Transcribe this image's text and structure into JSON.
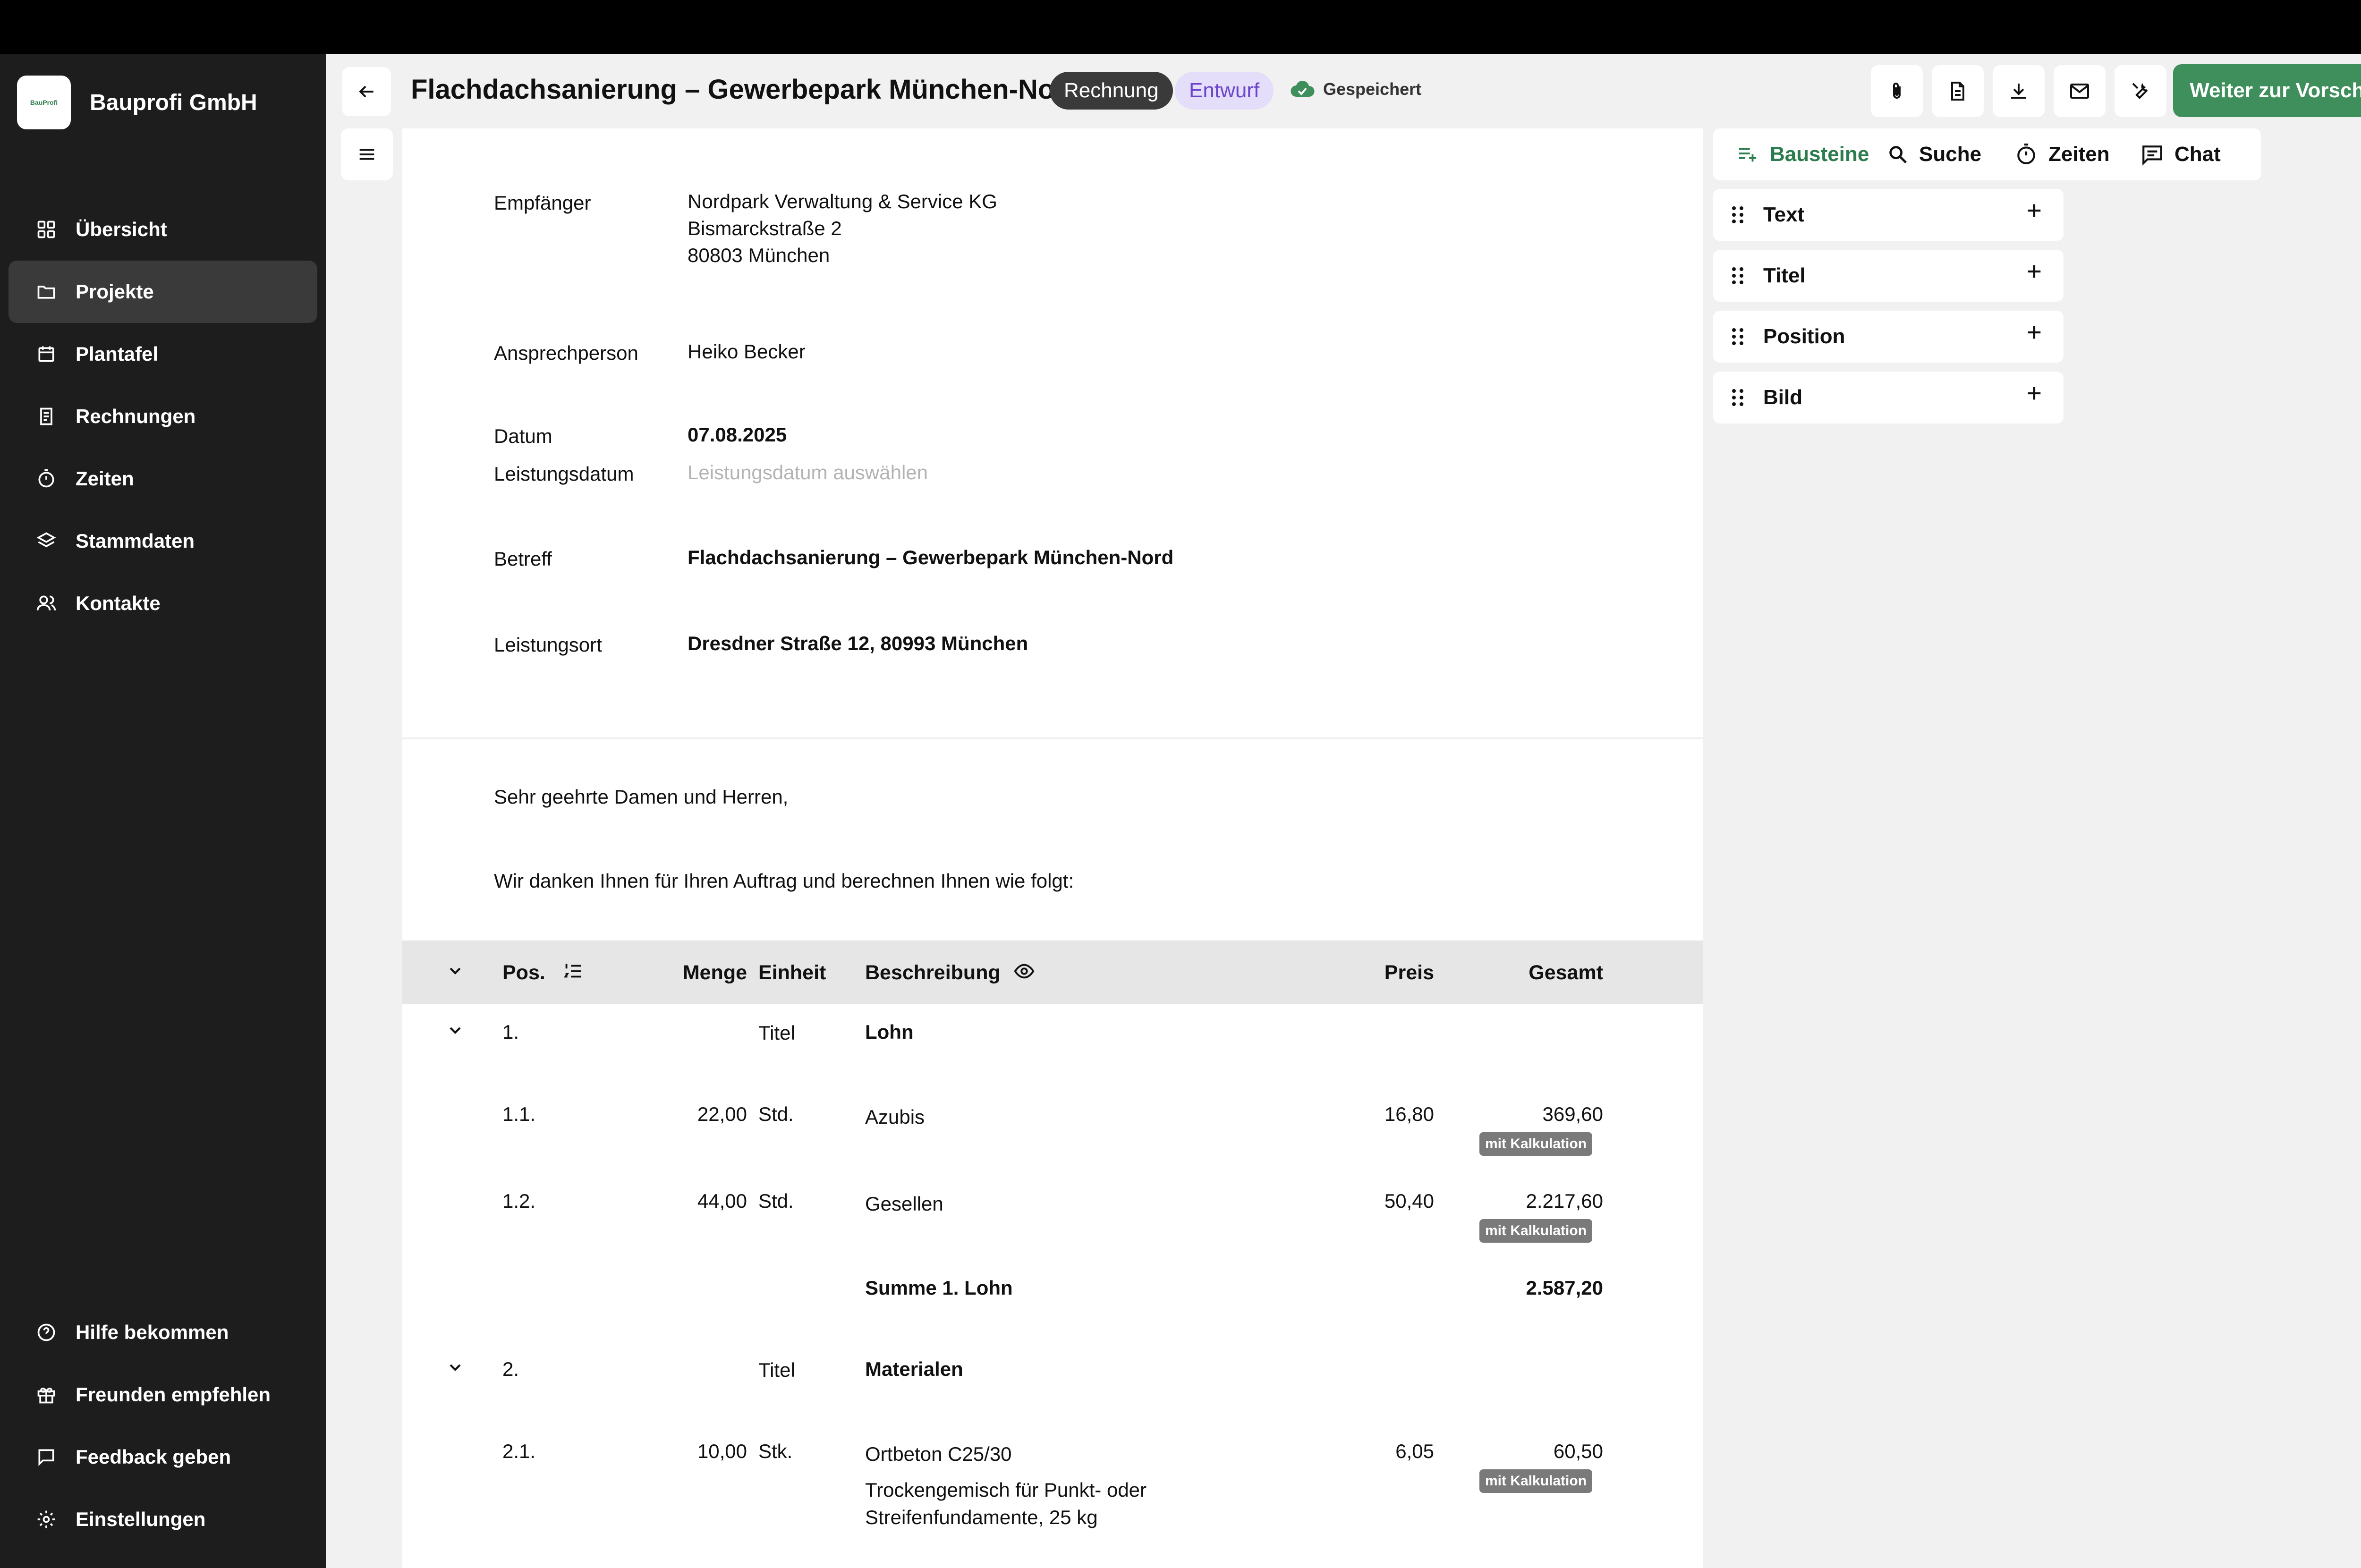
{
  "brand": {
    "name": "Bauprofi GmbH",
    "logo_text": "BauProfi"
  },
  "sidebar": {
    "items": [
      {
        "label": "Übersicht",
        "icon": "grid-icon"
      },
      {
        "label": "Projekte",
        "icon": "folder-icon",
        "active": true
      },
      {
        "label": "Plantafel",
        "icon": "calendar-icon"
      },
      {
        "label": "Rechnungen",
        "icon": "receipt-icon"
      },
      {
        "label": "Zeiten",
        "icon": "stopwatch-icon"
      },
      {
        "label": "Stammdaten",
        "icon": "layers-icon"
      },
      {
        "label": "Kontakte",
        "icon": "contacts-icon"
      }
    ],
    "bottom_items": [
      {
        "label": "Hilfe bekommen",
        "icon": "help-icon"
      },
      {
        "label": "Freunden empfehlen",
        "icon": "gift-icon"
      },
      {
        "label": "Feedback geben",
        "icon": "feedback-icon"
      },
      {
        "label": "Einstellungen",
        "icon": "gear-icon"
      }
    ]
  },
  "header": {
    "title": "Flachdachsanierung – Gewerbepark München-Nord",
    "type_badge": "Rechnung",
    "status_badge": "Entwurf",
    "saved_label": "Gespeichert",
    "preview_button": "Weiter zur Vorschau",
    "actions": [
      "paperclip-icon",
      "document-icon",
      "download-icon",
      "mail-icon",
      "tools-icon"
    ]
  },
  "document": {
    "recipient_label": "Empfänger",
    "recipient_lines": [
      "Nordpark Verwaltung & Service KG",
      "Bismarckstraße 2",
      "80803 München"
    ],
    "contact_label": "Ansprechperson",
    "contact_value": "Heiko Becker",
    "date_label": "Datum",
    "date_value": "07.08.2025",
    "service_date_label": "Leistungsdatum",
    "service_date_placeholder": "Leistungsdatum auswählen",
    "subject_label": "Betreff",
    "subject_value": "Flachdachsanierung – Gewerbepark München-Nord",
    "location_label": "Leistungsort",
    "location_value": "Dresdner Straße 12, 80993 München",
    "greeting": "Sehr geehrte Damen und Herren,",
    "intro": "Wir danken Ihnen für Ihren Auftrag und berechnen Ihnen wie folgt:"
  },
  "table": {
    "headers": {
      "pos": "Pos.",
      "menge": "Menge",
      "einheit": "Einheit",
      "beschreibung": "Beschreibung",
      "preis": "Preis",
      "gesamt": "Gesamt"
    },
    "badge_label": "mit Kalkulation",
    "group1": {
      "pos": "1.",
      "einheit": "Titel",
      "title": "Lohn",
      "sum_label": "Summe 1. Lohn",
      "sum_value": "2.587,20"
    },
    "row11": {
      "pos": "1.1.",
      "menge": "22,00",
      "einheit": "Std.",
      "beschreibung": "Azubis",
      "preis": "16,80",
      "gesamt": "369,60"
    },
    "row12": {
      "pos": "1.2.",
      "menge": "44,00",
      "einheit": "Std.",
      "beschreibung": "Gesellen",
      "preis": "50,40",
      "gesamt": "2.217,60"
    },
    "group2": {
      "pos": "2.",
      "einheit": "Titel",
      "title": "Materialen"
    },
    "row21": {
      "pos": "2.1.",
      "menge": "10,00",
      "einheit": "Stk.",
      "beschreibung": "Ortbeton C25/30",
      "detail1": "Trockengemisch für Punkt- oder",
      "detail2": "Streifenfundamente, 25 kg",
      "preis": "6,05",
      "gesamt": "60,50"
    }
  },
  "right_panel": {
    "tabs": [
      "Bausteine",
      "Suche",
      "Zeiten",
      "Chat"
    ],
    "blocks": [
      "Text",
      "Titel",
      "Position",
      "Bild"
    ]
  }
}
